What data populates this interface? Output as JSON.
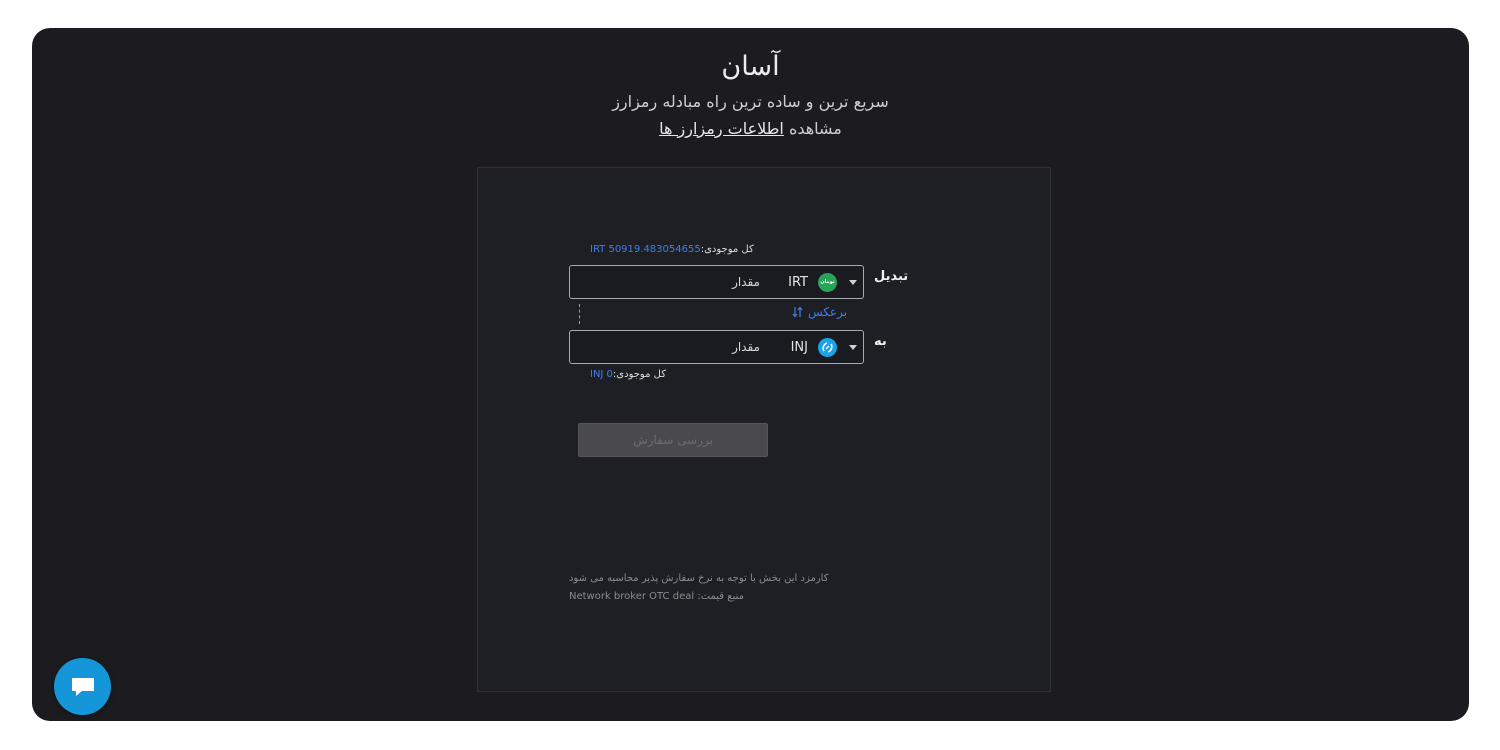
{
  "header": {
    "title": "آسان",
    "subtitle": "سریع ترین و ساده ترین راه مبادله رمزارز",
    "view_prefix": "مشاهده",
    "view_link": "اطلاعات رمزارز ها"
  },
  "form": {
    "from": {
      "balance_label": "کل موجودی:",
      "balance_value": "IRT 50919.483054655",
      "label": "تبدیل",
      "currency_code": "IRT",
      "currency_icon": "toman-coin-icon",
      "currency_icon_text": "تومان",
      "amount_placeholder": "مقدار"
    },
    "reverse_label": "برعکس",
    "to": {
      "label": "به",
      "currency_code": "INJ",
      "currency_icon": "injective-coin-icon",
      "amount_placeholder": "مقدار",
      "balance_label": "کل موجودی:",
      "balance_value": "INJ 0"
    },
    "submit_label": "بررسی سفارش",
    "fee_note": "کارمزد این بخش با توجه به نرخ سفارش پذیر محاسبه می شود",
    "price_source": "منبع قیمت: Network broker OTC deal"
  },
  "colors": {
    "accent_link": "#3f7ee8",
    "background": "#1c1c20",
    "chat_button": "#1496d9"
  }
}
